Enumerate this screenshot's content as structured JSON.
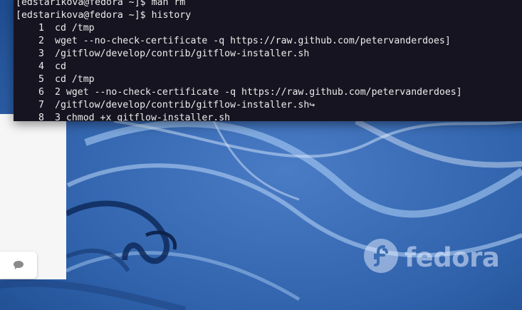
{
  "terminal": {
    "lines": [
      {
        "prompt": "[edstarikova@fedora ~]$ ",
        "command": "man rm"
      },
      {
        "prompt": "[edstarikova@fedora ~]$ ",
        "command": "history"
      }
    ],
    "history": [
      {
        "num": "1",
        "text": "cd /tmp"
      },
      {
        "num": "2",
        "text": "wget --no-check-certificate -q https://raw.github.com/petervanderdoes]"
      },
      {
        "num": "3",
        "text": "/gitflow/develop/contrib/gitflow-installer.sh"
      },
      {
        "num": "4",
        "text": "cd"
      },
      {
        "num": "5",
        "text": "cd /tmp"
      },
      {
        "num": "6",
        "text": "2 wget --no-check-certificate -q https://raw.github.com/petervanderdoes]"
      },
      {
        "num": "7",
        "text": "/gitflow/develop/contrib/gitflow-installer.sh↪"
      },
      {
        "num": "8",
        "text": "3 chmod +x gitflow-installer.sh"
      }
    ]
  },
  "desktop": {
    "logo_text": "fedora",
    "wallpaper_color": "#2e5fa8",
    "accent_color": "#3c6eb4"
  },
  "side_panel": {
    "chat_icon": "chat-bubble-icon"
  }
}
